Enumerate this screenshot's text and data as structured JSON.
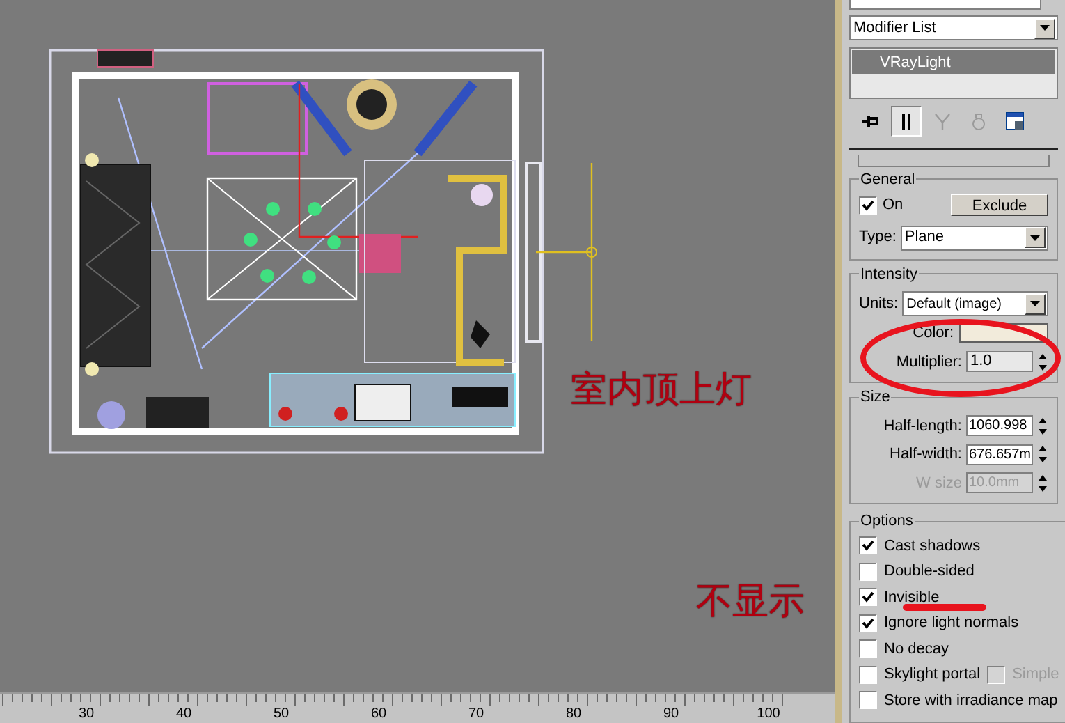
{
  "viewport": {
    "annotations": [
      {
        "kind": "label",
        "text": "室内顶上灯"
      },
      {
        "kind": "label",
        "text": "不显示"
      }
    ]
  },
  "ruler": {
    "labels": [
      "30",
      "40",
      "50",
      "60",
      "70",
      "80",
      "90",
      "100"
    ]
  },
  "panel": {
    "modifier_list": {
      "label": "Modifier List"
    },
    "stack": [
      {
        "label": "VRayLight",
        "selected": true
      }
    ],
    "toolbar": [
      {
        "kind": "pin",
        "selected": false,
        "disabled": false
      },
      {
        "kind": "pipe",
        "selected": true,
        "disabled": false
      },
      {
        "kind": "fork",
        "selected": false,
        "disabled": true
      },
      {
        "kind": "lock",
        "selected": false,
        "disabled": true
      },
      {
        "kind": "configure",
        "selected": false,
        "disabled": false
      }
    ],
    "general": {
      "title": "General",
      "on": {
        "label": "On",
        "checked": true
      },
      "exclude_button": "Exclude",
      "type": {
        "label": "Type:",
        "value": "Plane"
      }
    },
    "intensity": {
      "title": "Intensity",
      "units": {
        "label": "Units:",
        "value": "Default (image)"
      },
      "color": {
        "label": "Color:",
        "color": "#f2ebdb"
      },
      "multiplier": {
        "label": "Multiplier:",
        "value": "1.0"
      }
    },
    "size": {
      "title": "Size",
      "fields": [
        {
          "label": "Half-length:",
          "value": "1060.998",
          "disabled": false
        },
        {
          "label": "Half-width:",
          "value": "676.657m",
          "disabled": false
        },
        {
          "label": "W size",
          "value": "10.0mm",
          "disabled": true
        }
      ]
    },
    "options": {
      "title": "Options",
      "items": [
        {
          "label": "Cast shadows",
          "checked": true,
          "disabled": false
        },
        {
          "label": "Double-sided",
          "checked": false,
          "disabled": false
        },
        {
          "label": "Invisible",
          "checked": true,
          "disabled": false
        },
        {
          "label": "Ignore light normals",
          "checked": true,
          "disabled": false
        },
        {
          "label": "No decay",
          "checked": false,
          "disabled": false
        },
        {
          "label": "Skylight portal",
          "checked": false,
          "disabled": false,
          "extra": {
            "label": "Simple",
            "checked": false,
            "disabled": true
          }
        },
        {
          "label": "Store with irradiance map",
          "checked": false,
          "disabled": false
        }
      ]
    }
  }
}
